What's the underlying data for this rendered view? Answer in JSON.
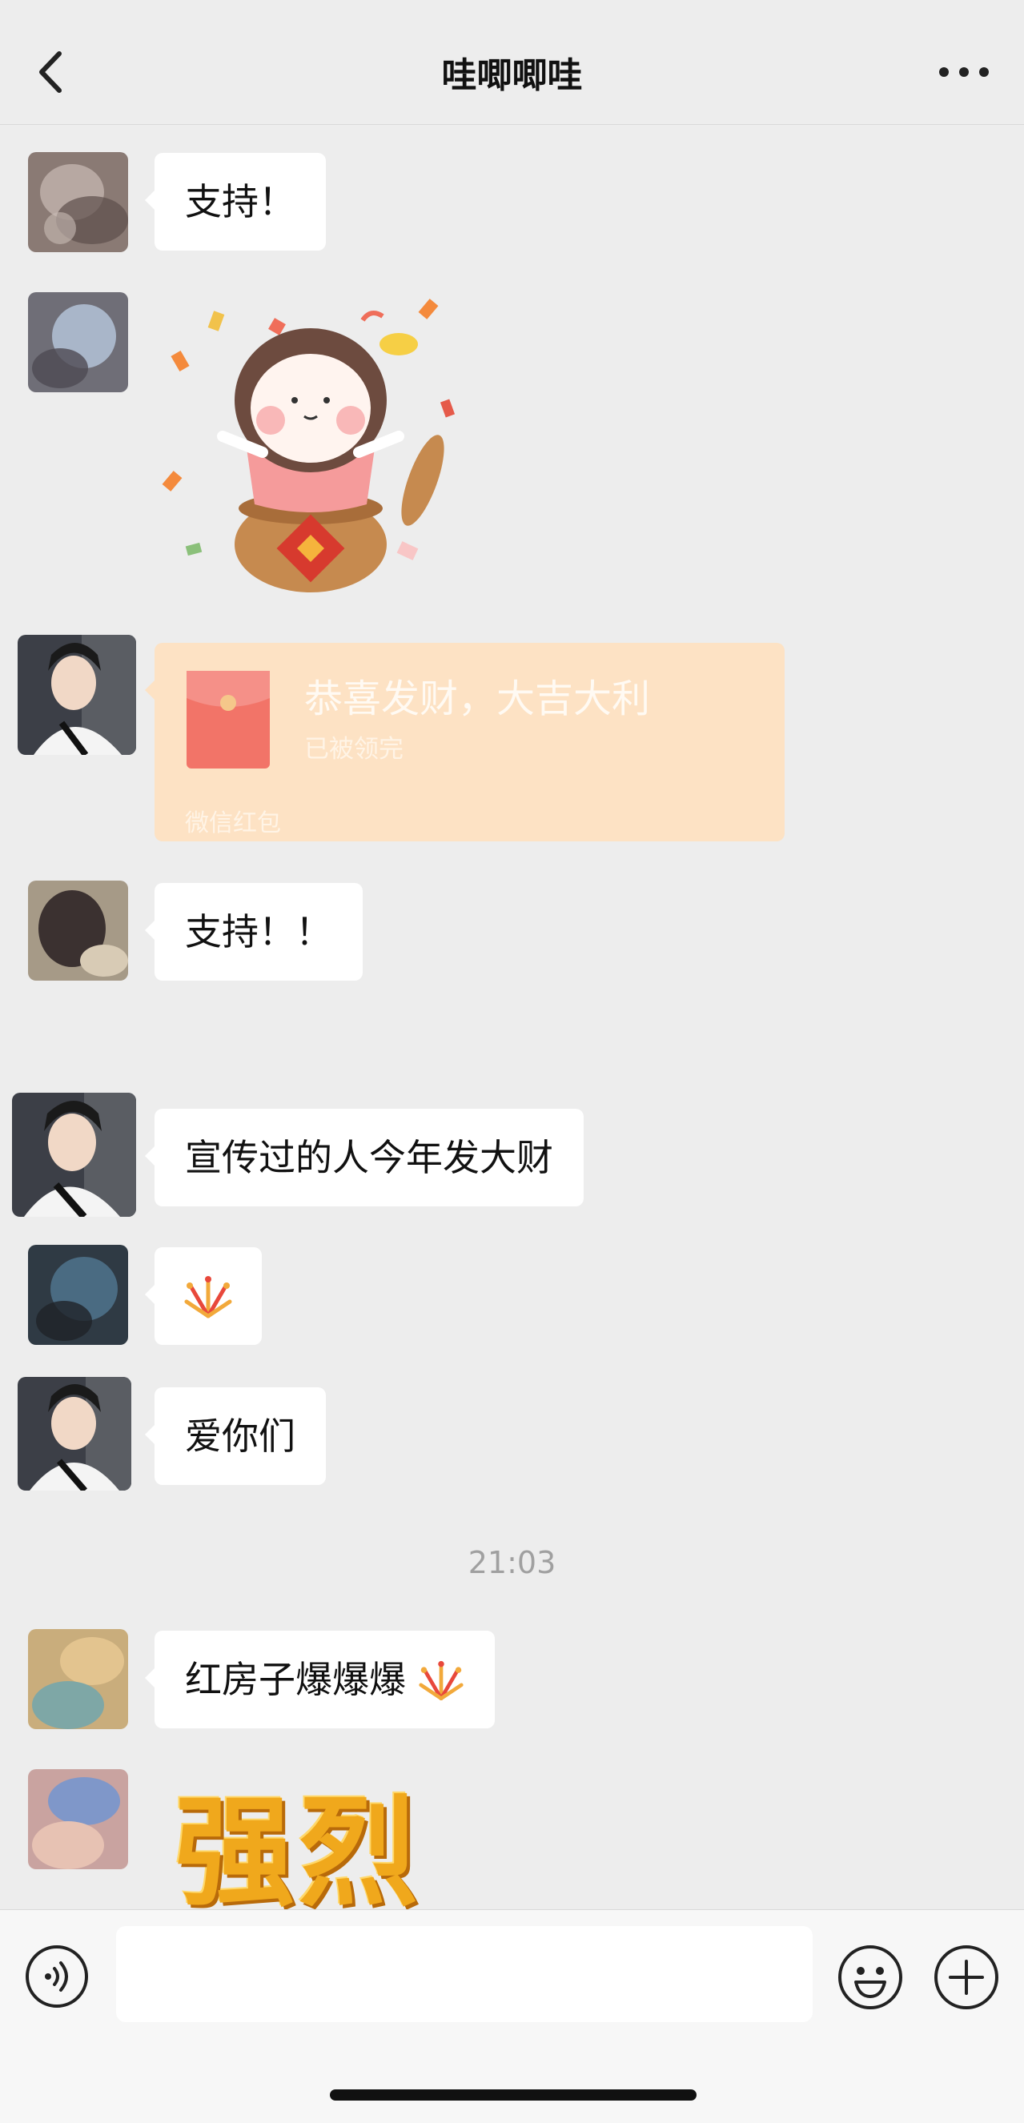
{
  "header": {
    "title": "哇唧唧哇",
    "back_icon": "chevron-left-icon",
    "more_icon": "ellipsis-icon"
  },
  "messages": [
    {
      "type": "text",
      "text": "支持！"
    },
    {
      "type": "sticker",
      "sticker": "celebration-sticker"
    },
    {
      "type": "red_packet",
      "title": "恭喜发财，大吉大利",
      "status": "已被领完",
      "footer": "微信红包"
    },
    {
      "type": "text",
      "text": "支持！！"
    },
    {
      "type": "text",
      "text": "宣传过的人今年发大财"
    },
    {
      "type": "text",
      "icon": "fireworks-icon"
    },
    {
      "type": "text",
      "text": "爱你们"
    },
    {
      "type": "text",
      "text": "红房子爆爆爆",
      "icon": "fireworks-icon"
    },
    {
      "type": "sticker",
      "sticker_text": "强烈"
    }
  ],
  "timestamp": "21:03",
  "input_bar": {
    "placeholder": "",
    "voice_icon": "voice-icon",
    "emoji_icon": "emoji-icon",
    "plus_icon": "plus-icon"
  },
  "colors": {
    "background": "#ededed",
    "bubble": "#ffffff",
    "red_packet": "#fde2c4",
    "sticker_gold": "#f0a81c"
  }
}
